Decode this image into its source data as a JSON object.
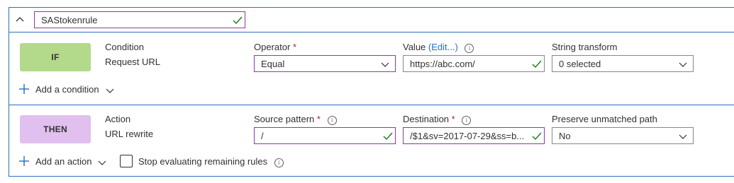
{
  "rule": {
    "name": "SAStokenrule",
    "colors": {
      "border": "#2b6fb8",
      "if_badge": "#b3d98a",
      "then_badge": "#e1bfee",
      "focus": "#8a3aa3",
      "check": "#107c10"
    }
  },
  "condition": {
    "badge": "IF",
    "col1_label": "Condition",
    "col1_value": "Request URL",
    "operator_label": "Operator",
    "operator_required": "*",
    "operator_value": "Equal",
    "value_label": "Value",
    "value_edit_link": "(Edit...)",
    "value_value": "https://abc.com/",
    "transform_label": "String transform",
    "transform_value": "0 selected",
    "add_label": "Add a condition"
  },
  "action": {
    "badge": "THEN",
    "col1_label": "Action",
    "col1_value": "URL rewrite",
    "source_label": "Source pattern",
    "source_required": "*",
    "source_value": "/",
    "dest_label": "Destination",
    "dest_required": "*",
    "dest_value": "/$1&sv=2017-07-29&ss=b...",
    "preserve_label": "Preserve unmatched path",
    "preserve_value": "No",
    "add_label": "Add an action",
    "stop_label": "Stop evaluating remaining rules",
    "stop_checked": false
  },
  "icons": {
    "collapse": "chevron-up-icon",
    "info": "info-icon",
    "add": "plus-icon",
    "dropdown": "chevron-down-icon",
    "valid": "checkmark-icon",
    "info_glyph": "i"
  }
}
